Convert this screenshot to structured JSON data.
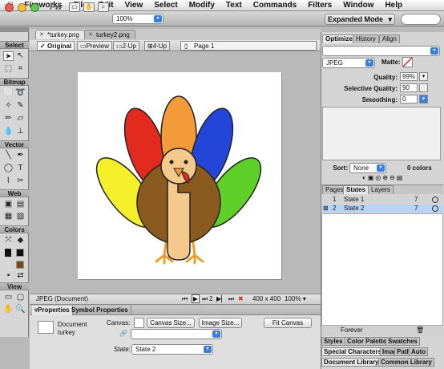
{
  "menubar": {
    "apple_icon": "apple-icon",
    "items": [
      "Fireworks",
      "File",
      "Edit",
      "View",
      "Select",
      "Modify",
      "Text",
      "Commands",
      "Filters",
      "Window",
      "Help"
    ]
  },
  "appbar": {
    "logo": "Fw",
    "zoom_value": "100%",
    "mode": "Expanded Mode"
  },
  "document_tabs": [
    {
      "label": "*turkey.png",
      "active": true
    },
    {
      "label": "turkey2.png",
      "active": false
    }
  ],
  "view_buttons": [
    {
      "label": "Original",
      "active": true
    },
    {
      "label": "Preview",
      "active": false
    },
    {
      "label": "2-Up",
      "active": false
    },
    {
      "label": "4-Up",
      "active": false
    }
  ],
  "page_selector": "Page 1",
  "tools": {
    "sections": [
      "Select",
      "Bitmap",
      "Vector",
      "Web",
      "Colors",
      "View"
    ]
  },
  "status_bar": {
    "format": "JPEG (Document)",
    "frame": "2",
    "size": "400 x 400",
    "zoom": "100%"
  },
  "properties": {
    "tabs": [
      "Properties",
      "Symbol Properties"
    ],
    "doc_label": "Document",
    "doc_name": "turkey",
    "canvas_label": "Canvas:",
    "canvas_size_btn": "Canvas Size...",
    "image_size_btn": "Image Size...",
    "fit_canvas_btn": "Fit Canvas",
    "state_label": "State:",
    "state_value": "State 2"
  },
  "optimize": {
    "tabs": [
      "Optimize",
      "History",
      "Align"
    ],
    "format": "JPEG",
    "matte_label": "Matte:",
    "quality_label": "Quality:",
    "quality_value": "99%",
    "selective_label": "Selective Quality:",
    "selective_value": "90",
    "smoothing_label": "Smoothing:",
    "smoothing_value": "0",
    "sort_label": "Sort:",
    "sort_value": "None",
    "colors_count": "0 colors"
  },
  "states": {
    "tabs": [
      "Pages",
      "States",
      "Layers"
    ],
    "rows": [
      {
        "num": "1",
        "name": "State 1",
        "delay": "7",
        "selected": false
      },
      {
        "num": "2",
        "name": "State 2",
        "delay": "7",
        "selected": true
      }
    ],
    "loop": "Forever"
  },
  "bottom_tabs": {
    "row1": [
      "Styles",
      "Color Palette",
      "Swatches"
    ],
    "row2": [
      "Special Characters",
      "Imag",
      "Path",
      "Auto"
    ],
    "row3": [
      "Document Library",
      "Common Library"
    ]
  },
  "colors": {
    "feather_red": "#e22a1f",
    "feather_orange": "#f39a3a",
    "feather_blue": "#2446d8",
    "feather_green": "#5fd02a",
    "feather_yellow": "#f5f02a",
    "body_brown": "#8b5a1e",
    "belly_tan": "#f5c98c",
    "accent_blue": "#3d7fd8"
  }
}
